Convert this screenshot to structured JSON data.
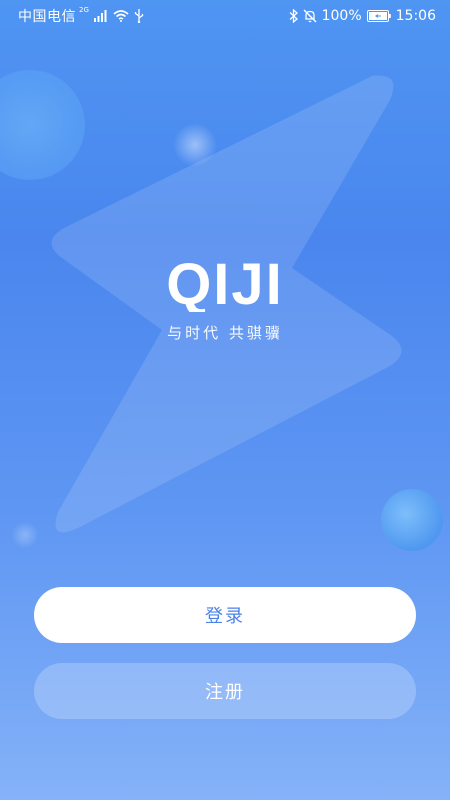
{
  "status_bar": {
    "carrier": "中国电信",
    "network_tag": "2G",
    "battery": "100%",
    "time": "15:06",
    "icons": [
      "signal-icon",
      "wifi-icon",
      "usb-icon",
      "bluetooth-icon",
      "mute-bell-icon",
      "battery-icon"
    ]
  },
  "brand": {
    "logo_text": "QIJI",
    "slogan": "与时代 共骐骥"
  },
  "actions": {
    "login_label": "登录",
    "register_label": "注册"
  },
  "colors": {
    "bg_top": "#4f95f2",
    "bg_bottom": "#85b2f8",
    "login_text": "#4b82e8"
  }
}
